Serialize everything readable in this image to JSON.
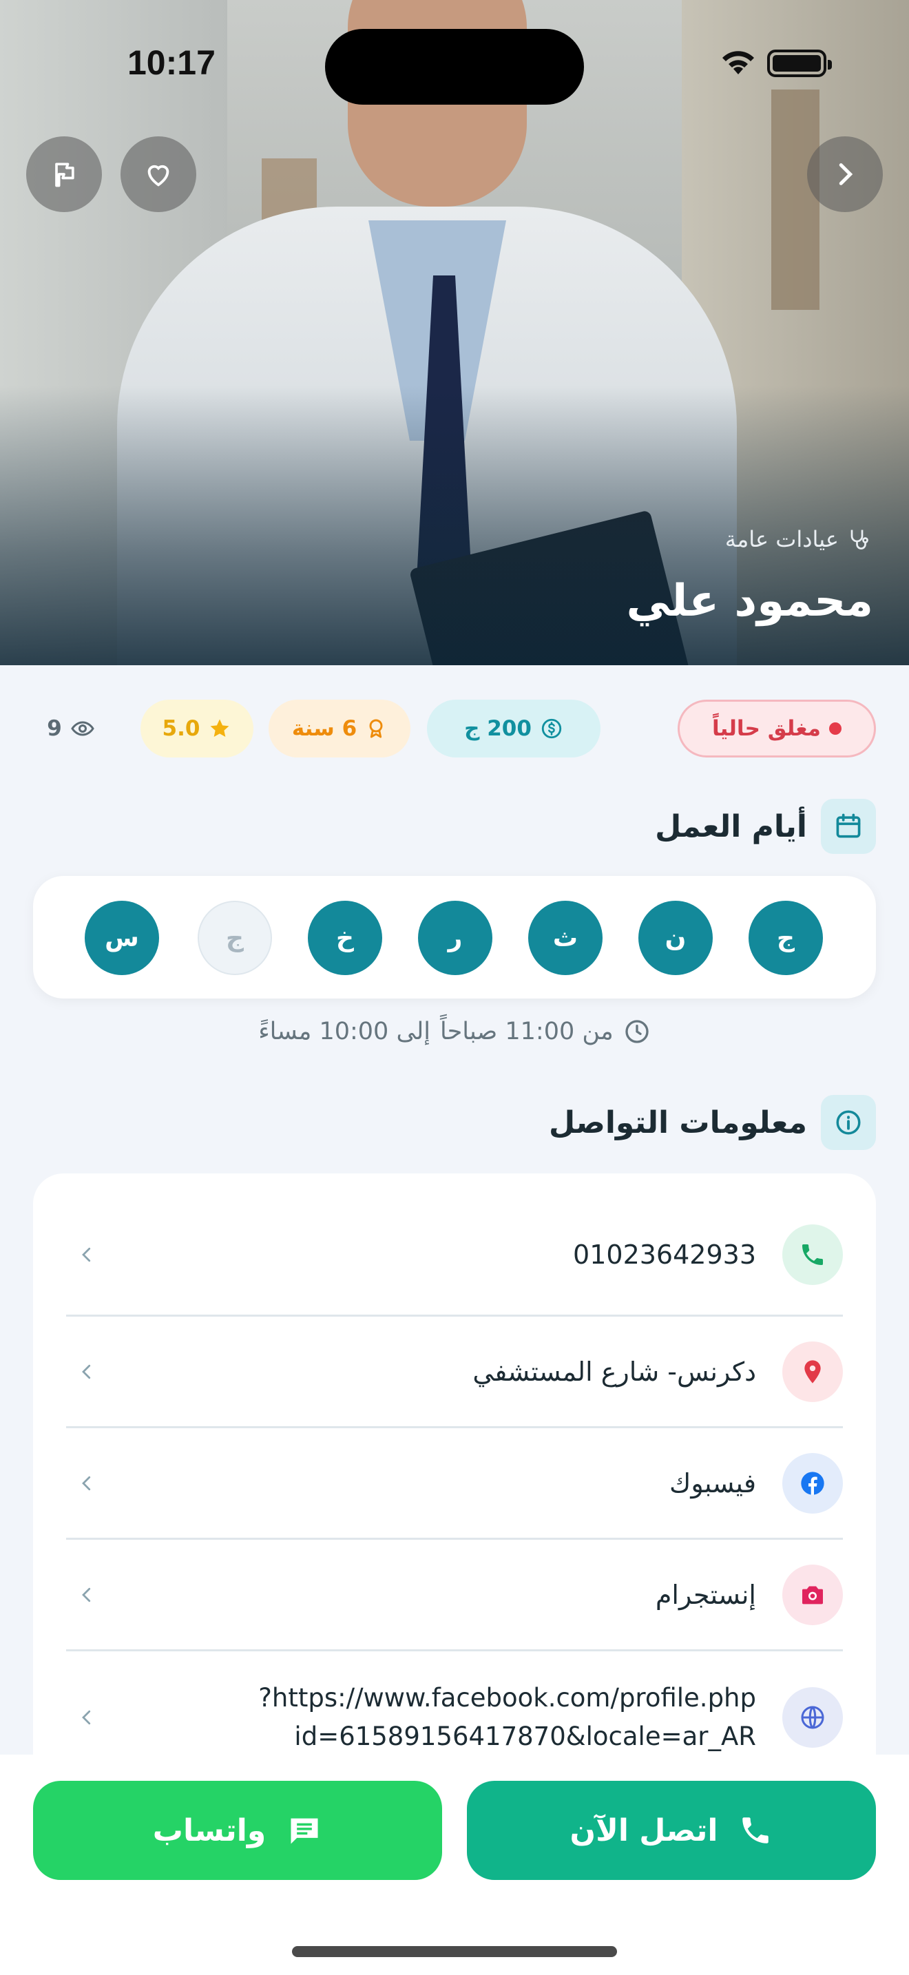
{
  "status_bar": {
    "time": "10:17"
  },
  "hero": {
    "category": "عيادات عامة",
    "doctor_name": "محمود علي"
  },
  "chips": {
    "status": "مغلق حالياً",
    "price": "200 ج",
    "experience": "6 سنة",
    "rating": "5.0",
    "views": "9"
  },
  "work_days": {
    "title": "أيام العمل",
    "days": [
      {
        "label": "ج",
        "active": true
      },
      {
        "label": "ن",
        "active": true
      },
      {
        "label": "ث",
        "active": true
      },
      {
        "label": "ر",
        "active": true
      },
      {
        "label": "خ",
        "active": true
      },
      {
        "label": "ج",
        "active": false
      },
      {
        "label": "س",
        "active": true
      }
    ],
    "hours_from": "من 11:00 صباحاً",
    "hours_to": "إلى 10:00 مساءً"
  },
  "contact": {
    "title": "معلومات التواصل",
    "phone": "01023642933",
    "address": "دكرنس- شارع المستشفي",
    "facebook": "فيسبوك",
    "instagram": "إنستجرام",
    "website_line1": "https://www.facebook.com/profile.php?",
    "website_line2": "id=61589156417870&locale=ar_AR"
  },
  "actions": {
    "call_label": "اتصل الآن",
    "whatsapp_label": "واتساب"
  },
  "colors": {
    "primary": "#13899a",
    "call": "#10b48a",
    "whatsapp": "#25d366",
    "closed": "#d53c4a"
  },
  "icons": [
    "flag-icon",
    "heart-icon",
    "chevron-right-icon",
    "stethoscope-icon",
    "dollar-icon",
    "award-icon",
    "star-icon",
    "eye-icon",
    "calendar-icon",
    "clock-icon",
    "info-icon",
    "phone-icon",
    "location-pin-icon",
    "facebook-icon",
    "camera-icon",
    "globe-icon",
    "chevron-left-icon",
    "chat-icon"
  ]
}
